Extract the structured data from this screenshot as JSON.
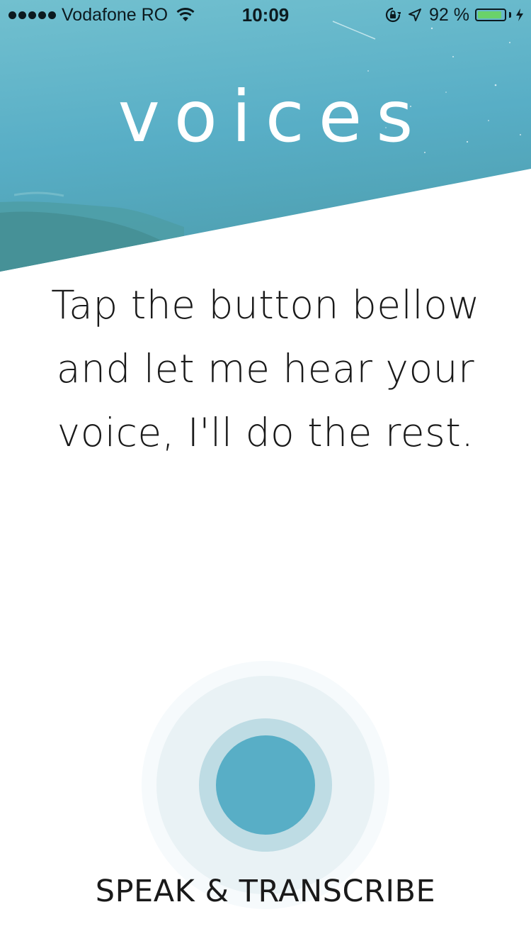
{
  "status_bar": {
    "carrier": "Vodafone RO",
    "time": "10:09",
    "battery_percent": "92 %",
    "battery_level": 0.92,
    "battery_color": "#6ad26a"
  },
  "app": {
    "title": "voices"
  },
  "main": {
    "instruction_lines": [
      "Tap the button bellow",
      "and let me hear your",
      "voice, I'll do the rest."
    ],
    "action_label": "SPEAK & TRANSCRIBE"
  },
  "colors": {
    "hero_teal": "#5cb1c4",
    "record_button": "#58aec6"
  },
  "icons": {
    "signal": "signal-dots-icon",
    "wifi": "wifi-icon",
    "orientation_lock": "orientation-lock-icon",
    "location": "location-arrow-icon",
    "battery": "battery-icon",
    "charging": "charging-bolt-icon"
  }
}
